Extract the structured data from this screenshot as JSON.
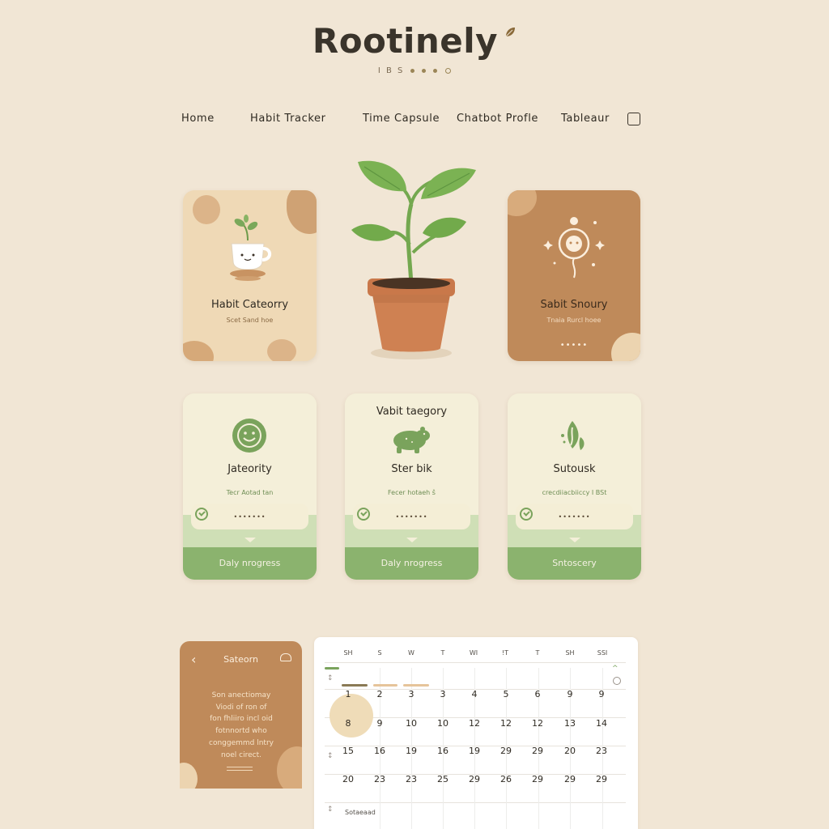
{
  "brand": {
    "name": "Rootinely",
    "tagline": "I B S"
  },
  "nav": {
    "items": [
      "Home",
      "Habit Tracker",
      "Time Capsule",
      "Chatbot Profle",
      "Tableaur"
    ]
  },
  "top_cards": {
    "left": {
      "title": "Habit Cateorry",
      "subtitle": "Scet Sand hoe"
    },
    "right": {
      "title": "Sabit Snoury",
      "subtitle": "Tnaia Rurcl hoee",
      "dots": "•••••"
    }
  },
  "habit_cards": [
    {
      "title": "Jateority",
      "subtitle": "Tecr Aotad tan",
      "dots": "•••••••",
      "button": "Daly nrogress"
    },
    {
      "title": "Ster bik",
      "heading": "Vabit taegory",
      "subtitle": "Fecer hotaeh ŝ",
      "dots": "•••••••",
      "button": "Daly nrogress"
    },
    {
      "title": "Sutousk",
      "subtitle": "crecdiiacbiiccy I BSt",
      "dots": "•••••••",
      "button": "Sntoscery"
    }
  ],
  "side_panel": {
    "title": "Sateorn",
    "body_lines": [
      "Son anectiomay",
      "Viodi of ron of",
      "fon fhliiro incl oid",
      "fotnnortd who",
      "conggemmd lntry",
      "noel cirect."
    ]
  },
  "calendar": {
    "weekdays": [
      "SH",
      "S",
      "W",
      "T",
      "WI",
      "!T",
      "T",
      "SH",
      "SSI"
    ],
    "weeks": [
      [
        "1",
        "2",
        "3",
        "3",
        "4",
        "5",
        "6",
        "9",
        "9"
      ],
      [
        "8",
        "9",
        "10",
        "10",
        "12",
        "12",
        "12",
        "13",
        "14"
      ],
      [
        "15",
        "16",
        "19",
        "16",
        "19",
        "29",
        "29",
        "20",
        "23"
      ],
      [
        "20",
        "23",
        "23",
        "25",
        "29",
        "26",
        "29",
        "29",
        "29"
      ]
    ],
    "footer": "Sotaeaad"
  },
  "colors": {
    "background": "#f1e6d5",
    "brown": "#bf8a5a",
    "green": "#8bb36e",
    "cream": "#f4efd9"
  }
}
